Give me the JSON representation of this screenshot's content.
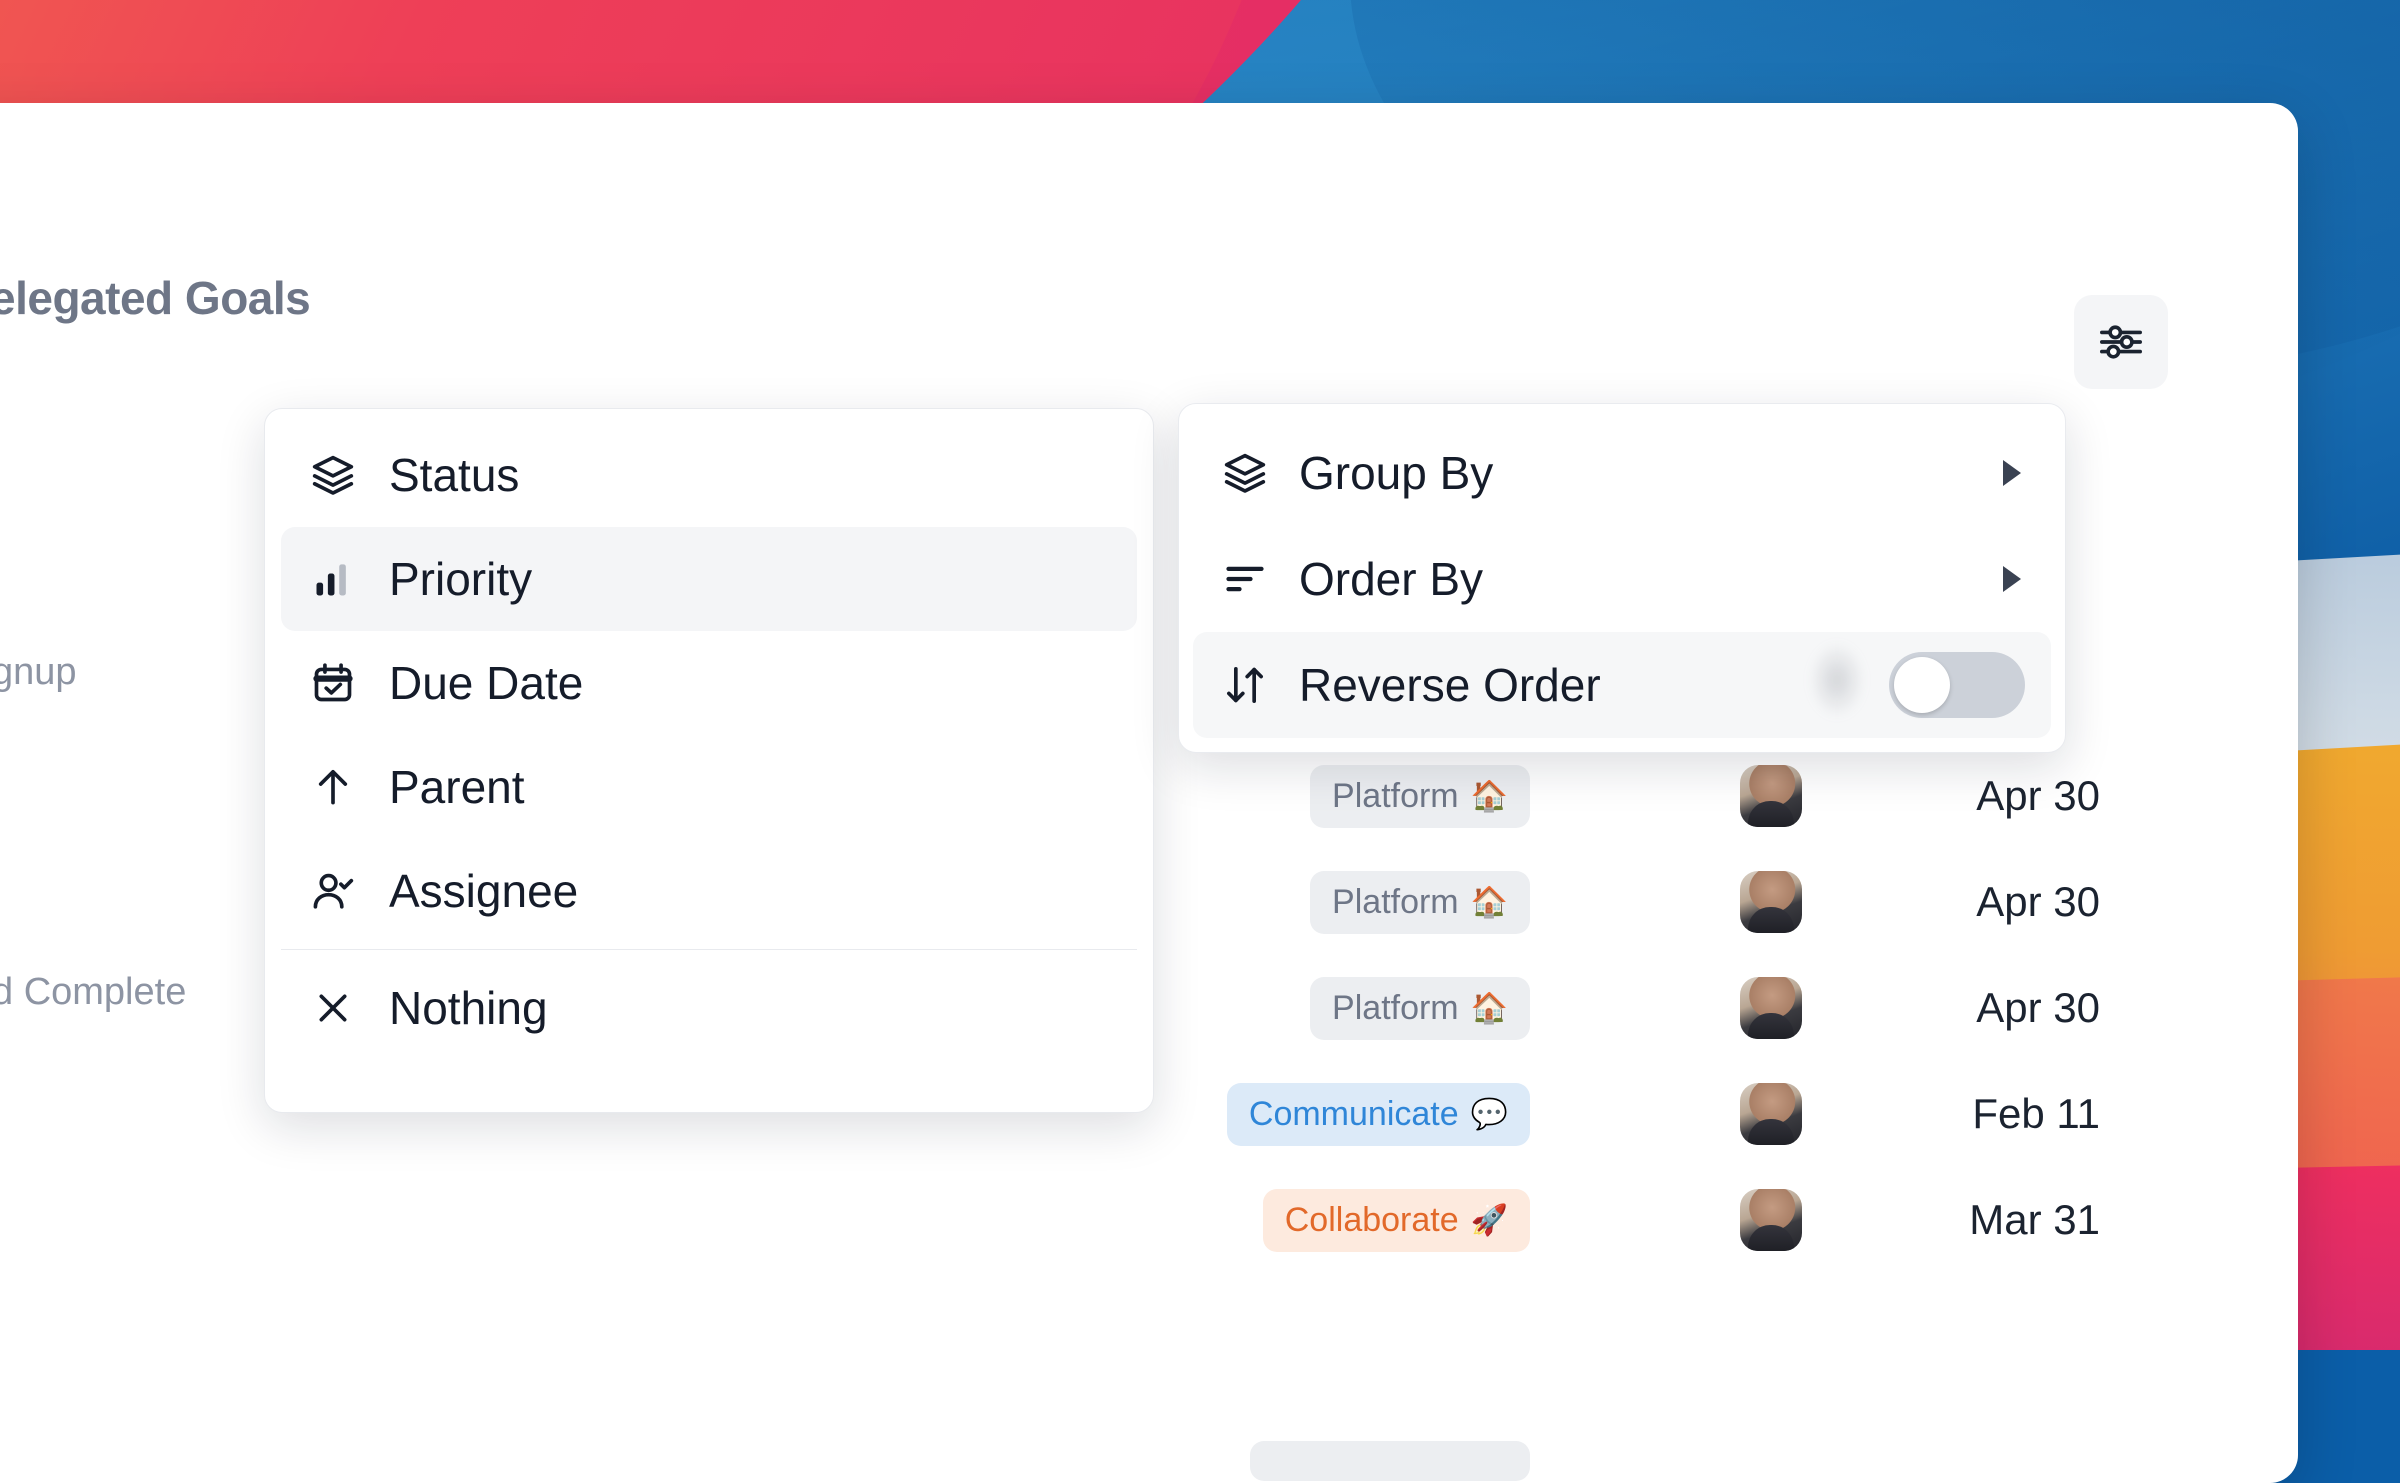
{
  "window": {
    "page_title": "elegated Goals"
  },
  "toolbar": {
    "filter_icon": "sliders-icon"
  },
  "snippets": {
    "signup": "gnup",
    "complete": "d Complete"
  },
  "submenu": {
    "items": [
      {
        "label": "Status",
        "icon": "layers-icon",
        "selected": false
      },
      {
        "label": "Priority",
        "icon": "bar-chart-icon",
        "selected": true
      },
      {
        "label": "Due Date",
        "icon": "calendar-check-icon",
        "selected": false
      },
      {
        "label": "Parent",
        "icon": "arrow-up-icon",
        "selected": false
      },
      {
        "label": "Assignee",
        "icon": "user-check-icon",
        "selected": false
      }
    ],
    "footer_item": {
      "label": "Nothing",
      "icon": "close-x-icon"
    }
  },
  "menu": {
    "items": [
      {
        "label": "Group By",
        "icon": "layers-icon",
        "control": "chevron",
        "hovered": false
      },
      {
        "label": "Order By",
        "icon": "sort-lines-icon",
        "control": "chevron",
        "hovered": false
      },
      {
        "label": "Reverse Order",
        "icon": "arrow-updown-icon",
        "control": "toggle",
        "hovered": true,
        "toggle_on": false
      }
    ]
  },
  "table": {
    "rows": [
      {
        "tag": "Platform",
        "tag_emoji": "🏠",
        "tag_style": "platform",
        "avatar": "user-avatar",
        "date": "Apr 30"
      },
      {
        "tag": "Platform",
        "tag_emoji": "🏠",
        "tag_style": "platform",
        "avatar": "user-avatar",
        "date": "Apr 30"
      },
      {
        "tag": "Platform",
        "tag_emoji": "🏠",
        "tag_style": "platform",
        "avatar": "user-avatar",
        "date": "Apr 30"
      },
      {
        "tag": "Communicate",
        "tag_emoji": "💬",
        "tag_style": "communicate",
        "avatar": "user-avatar",
        "date": "Feb 11"
      },
      {
        "tag": "Collaborate",
        "tag_emoji": "🚀",
        "tag_style": "collaborate",
        "avatar": "user-avatar",
        "date": "Mar 31"
      }
    ]
  },
  "colors": {
    "title": "#6e7687",
    "menu_text": "#151c2a",
    "tag_platform_bg": "#eceef1",
    "tag_platform_text": "#6e7687",
    "tag_communicate_bg": "#dceaf8",
    "tag_communicate_text": "#2f86d8",
    "tag_collaborate_bg": "#fdeade",
    "tag_collaborate_text": "#e2692a",
    "toggle_off": "#ccd1d9",
    "selected_row_bg": "#f4f5f7"
  }
}
